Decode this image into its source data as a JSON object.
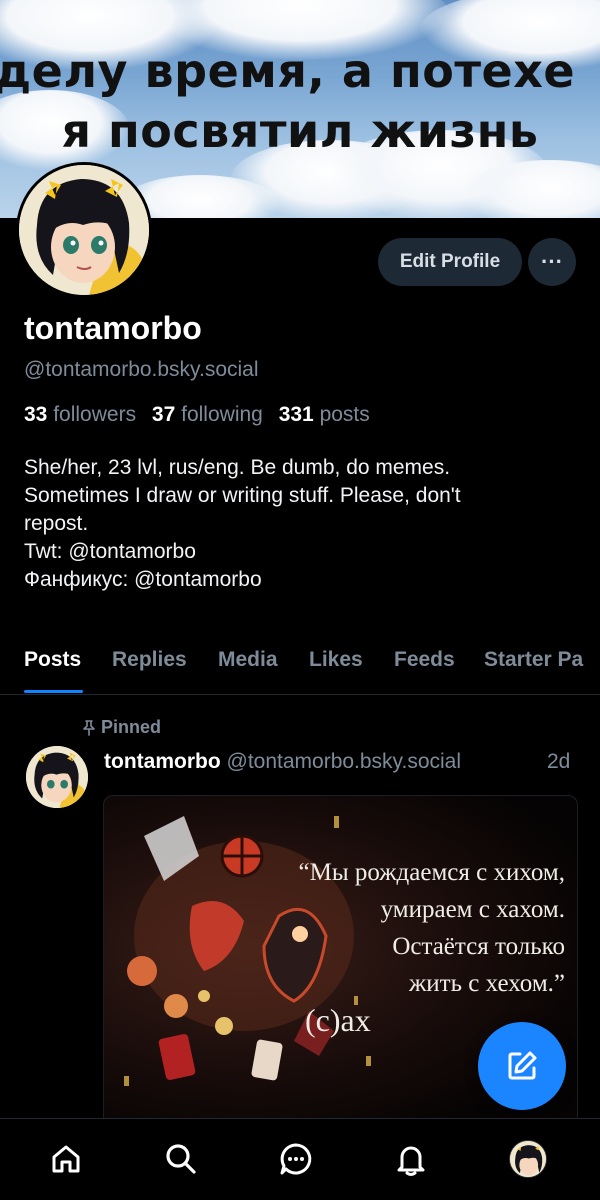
{
  "banner": {
    "line1": "делу время, а потехе",
    "line2": "я посвятил жизнь"
  },
  "profile": {
    "display_name": "tontamorbo",
    "handle": "@tontamorbo.bsky.social",
    "edit_label": "Edit Profile",
    "more_label": "···",
    "stats": {
      "followers_count": "33",
      "followers_label": "followers",
      "following_count": "37",
      "following_label": "following",
      "posts_count": "331",
      "posts_label": "posts"
    },
    "bio_lines": [
      "She/her, 23 lvl, rus/eng. Be dumb, do memes.",
      "Sometimes I draw or writing stuff. Please, don't",
      "repost.",
      "Twt: @tontamorbo",
      "Фанфикус: @tontamorbo"
    ]
  },
  "tabs": [
    {
      "label": "Posts"
    },
    {
      "label": "Replies"
    },
    {
      "label": "Media"
    },
    {
      "label": "Likes"
    },
    {
      "label": "Feeds"
    },
    {
      "label": "Starter Pa"
    }
  ],
  "post": {
    "pinned_label": "Pinned",
    "author_name": "tontamorbo",
    "author_handle": "@tontamorbo.bsky.social",
    "time": "2d",
    "image_quote_lines": [
      "“Мы рождаемся с хихом,",
      "умираем с хахом.",
      "Остаётся только",
      "жить с хехом.”",
      "(с)ах"
    ]
  },
  "nav": {
    "items": [
      "home-icon",
      "search-icon",
      "chat-icon",
      "bell-icon",
      "profile-avatar"
    ]
  },
  "colors": {
    "accent": "#1083fe",
    "muted_text": "#7e8b99",
    "button_bg": "#1e2936",
    "fab": "#1a85ff"
  }
}
